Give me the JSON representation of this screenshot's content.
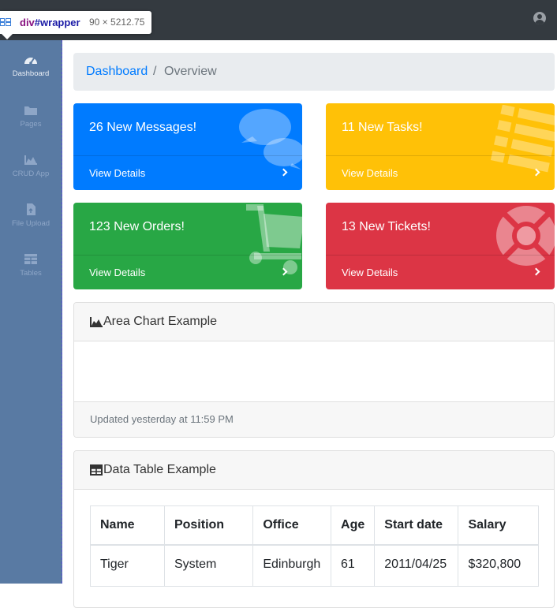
{
  "devtools_tooltip": {
    "tag": "div",
    "id": "#wrapper",
    "size": "90 × 5212.75"
  },
  "sidebar": {
    "items": [
      {
        "label": "Dashboard",
        "icon": "tachometer-icon",
        "active": true
      },
      {
        "label": "Pages",
        "icon": "folder-icon"
      },
      {
        "label": "CRUD App",
        "icon": "area-chart-icon"
      },
      {
        "label": "File Upload",
        "icon": "file-icon"
      },
      {
        "label": "Tables",
        "icon": "table-icon"
      }
    ]
  },
  "breadcrumb": {
    "link": "Dashboard",
    "separator": "/",
    "current": "Overview"
  },
  "cards": [
    {
      "title": "26 New Messages!",
      "footer": "View Details",
      "color": "#007bff",
      "icon": "comments-icon"
    },
    {
      "title": "11 New Tasks!",
      "footer": "View Details",
      "color": "#ffc107",
      "icon": "list-icon"
    },
    {
      "title": "123 New Orders!",
      "footer": "View Details",
      "color": "#28a745",
      "icon": "shopping-cart-icon"
    },
    {
      "title": "13 New Tickets!",
      "footer": "View Details",
      "color": "#dc3545",
      "icon": "life-ring-icon"
    }
  ],
  "area_chart": {
    "title": "Area Chart Example",
    "footer": "Updated yesterday at 11:59 PM"
  },
  "data_table": {
    "title": "Data Table Example",
    "columns": [
      "Name",
      "Position",
      "Office",
      "Age",
      "Start date",
      "Salary"
    ],
    "rows": [
      [
        "Tiger",
        "System",
        "Edinburgh",
        "61",
        "2011/04/25",
        "$320,800"
      ]
    ]
  }
}
